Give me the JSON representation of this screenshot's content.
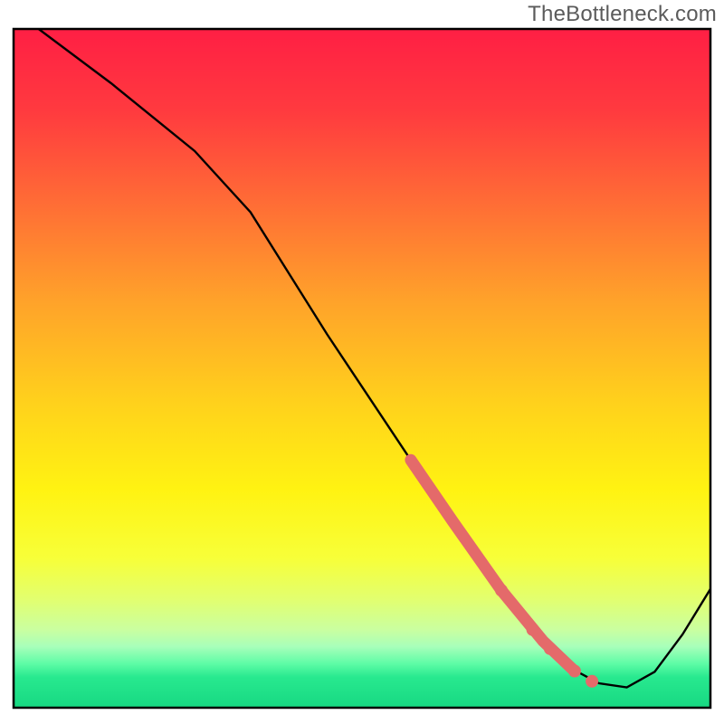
{
  "watermark": "TheBottleneck.com",
  "colors": {
    "line": "#000000",
    "marker": "#e46a6a",
    "frame": "#000000",
    "gradient_stops": [
      {
        "o": 0.0,
        "c": "#ff1f44"
      },
      {
        "o": 0.12,
        "c": "#ff3a3f"
      },
      {
        "o": 0.25,
        "c": "#ff6a36"
      },
      {
        "o": 0.4,
        "c": "#ffa22a"
      },
      {
        "o": 0.55,
        "c": "#ffd11c"
      },
      {
        "o": 0.68,
        "c": "#fff312"
      },
      {
        "o": 0.78,
        "c": "#f7ff39"
      },
      {
        "o": 0.84,
        "c": "#e2ff6f"
      },
      {
        "o": 0.885,
        "c": "#caffa0"
      },
      {
        "o": 0.91,
        "c": "#a8ffba"
      },
      {
        "o": 0.935,
        "c": "#5efca6"
      },
      {
        "o": 0.955,
        "c": "#28e98f"
      },
      {
        "o": 1.0,
        "c": "#17d882"
      }
    ]
  },
  "chart_data": {
    "type": "line",
    "title": "",
    "xlabel": "",
    "ylabel": "",
    "xlim": [
      0,
      100
    ],
    "ylim": [
      0,
      100
    ],
    "note": "Axes are unlabeled; values are normalized 0–100. y ≈ bottleneck/mismatch percentage (0 = ideal green band at bottom). Curve descends from top-left, flattens near y≈3 around x≈80–88, then rises toward the right edge.",
    "series": [
      {
        "name": "curve",
        "x": [
          3.6,
          14.0,
          26.0,
          34.0,
          45.0,
          57.0,
          63.0,
          70.0,
          76.0,
          80.0,
          84.0,
          88.0,
          92.0,
          96.0,
          100.0
        ],
        "y": [
          100.0,
          92.0,
          82.0,
          73.0,
          55.0,
          36.5,
          27.5,
          17.3,
          9.8,
          5.8,
          3.6,
          3.0,
          5.3,
          10.8,
          17.5
        ]
      }
    ],
    "highlight_segment": {
      "description": "Thick salmon overlay on the descending portion of the curve indicating the commonly selected configuration range.",
      "x_range": [
        57.0,
        80.5
      ],
      "points": [
        {
          "x": 57.0,
          "y": 36.5
        },
        {
          "x": 63.0,
          "y": 27.5
        },
        {
          "x": 70.0,
          "y": 17.3
        },
        {
          "x": 76.0,
          "y": 9.8
        },
        {
          "x": 80.5,
          "y": 5.4
        }
      ],
      "extra_dots": [
        {
          "x": 70.0,
          "y": 17.3
        },
        {
          "x": 74.5,
          "y": 11.5
        },
        {
          "x": 77.0,
          "y": 8.7
        },
        {
          "x": 80.5,
          "y": 5.4
        },
        {
          "x": 83.0,
          "y": 3.9
        }
      ]
    }
  }
}
